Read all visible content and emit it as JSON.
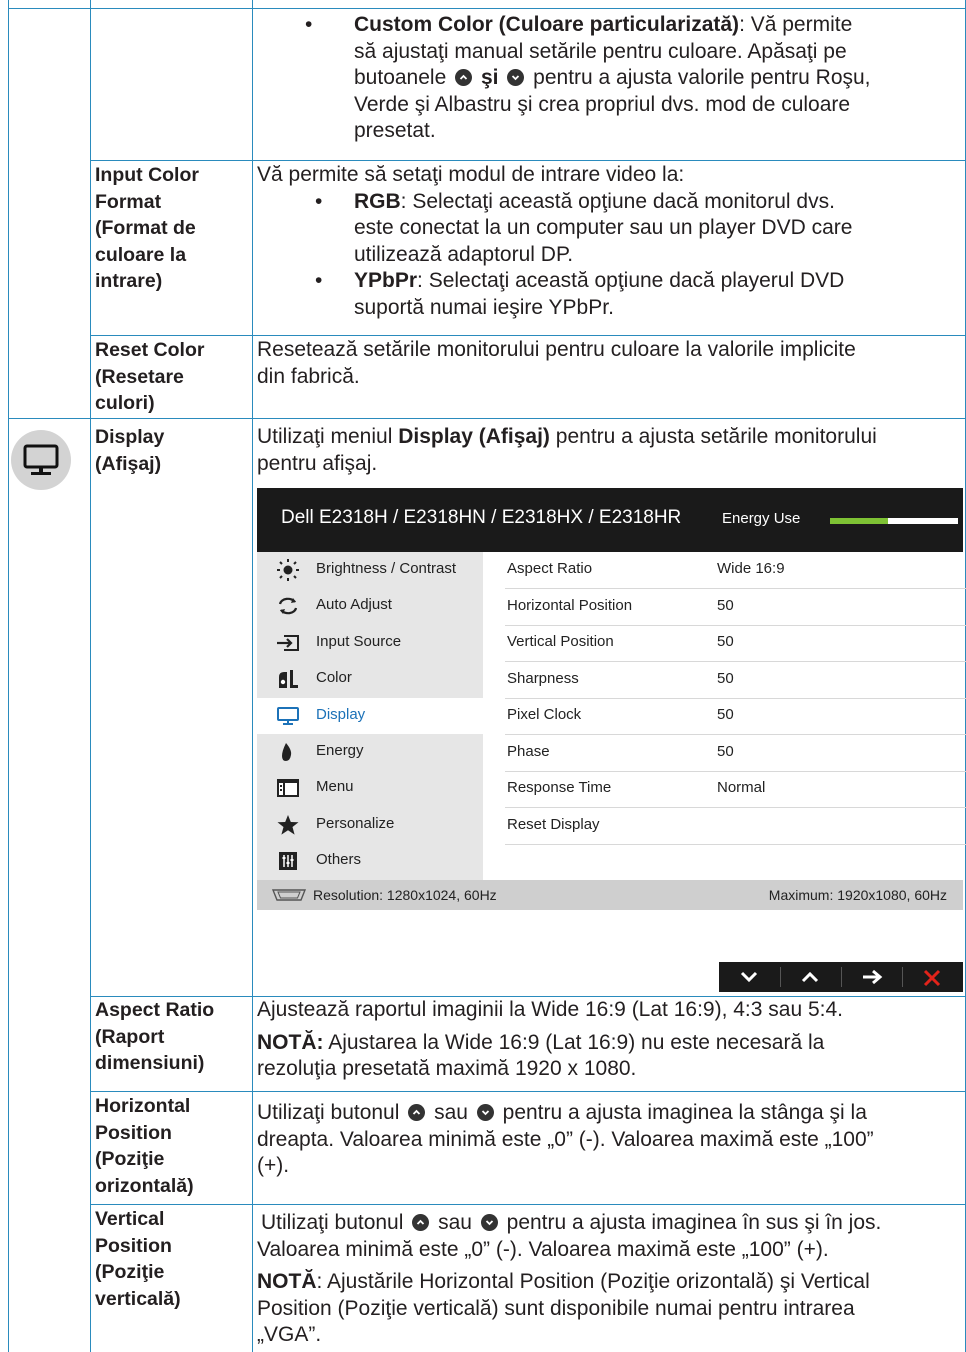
{
  "rows": {
    "custom_color": {
      "bullet": "•",
      "title": "Custom Color (Culoare particularizată)",
      "line1_rest": ": Vă permite",
      "line2": "să ajustaţi manual setările pentru culoare. Apăsaţi pe",
      "line3_a": "butoanele",
      "line3_b": "şi",
      "line3_c": "pentru a ajusta valorile pentru Roşu,",
      "line4": "Verde şi Albastru şi crea propriul dvs. mod de culoare",
      "line5": "presetat."
    },
    "input_color_format": {
      "label": [
        "Input Color",
        "Format",
        "(Format de",
        "culoare la",
        "intrare)"
      ],
      "intro": "Vă permite să setaţi modul de intrare video la:",
      "bullet": "•",
      "rgb_title": "RGB",
      "rgb_line1": ": Selectaţi această opţiune dacă monitorul dvs.",
      "rgb_line2": "este conectat la un computer sau un player DVD care",
      "rgb_line3": "utilizează adaptorul DP.",
      "ypbpr_title": "YPbPr",
      "ypbpr_line1": ": Selectaţi această opţiune dacă playerul DVD",
      "ypbpr_line2": "suportă numai ieşire YPbPr."
    },
    "reset_color": {
      "label": [
        "Reset Color",
        "(Resetare",
        "culori)"
      ],
      "line1": "Resetează setările monitorului pentru culoare la valorile implicite",
      "line2": "din fabrică."
    },
    "display": {
      "label": [
        "Display",
        "(Afişaj)"
      ],
      "line1_a": "Utilizaţi meniul",
      "line1_b": "Display (Afişaj)",
      "line1_c": "pentru a ajusta setările monitorului",
      "line2": "pentru afişaj."
    },
    "aspect_ratio": {
      "label": [
        "Aspect Ratio",
        "(Raport",
        "dimensiuni)"
      ],
      "line1": "Ajustează raportul imaginii la Wide 16:9 (Lat 16:9), 4:3 sau 5:4.",
      "note_label": "NOTĂ:",
      "note_line1": "Ajustarea la Wide 16:9 (Lat 16:9) nu este necesară la",
      "note_line2": "rezoluţia presetată maximă 1920 x 1080."
    },
    "horizontal_position": {
      "label": [
        "Horizontal",
        "Position",
        "(Poziţie",
        "orizontală)"
      ],
      "line1_a": "Utilizaţi butonul",
      "line1_b": "sau",
      "line1_c": "pentru a ajusta imaginea la stânga şi la",
      "line2": "dreapta. Valoarea minimă este „0” (-). Valoarea maximă este „100”",
      "line3": "(+)."
    },
    "vertical_position": {
      "label": [
        "Vertical",
        "Position",
        "(Poziţie",
        "verticală)"
      ],
      "line1_a": "Utilizaţi butonul",
      "line1_b": "sau",
      "line1_c": "pentru a ajusta imaginea în sus şi în jos.",
      "line2": "Valoarea minimă este „0” (-). Valoarea maximă este „100” (+).",
      "note_label": "NOTĂ",
      "note_line1": ": Ajustările Horizontal Position (Poziţie orizontală) şi Vertical",
      "note_line2": "Position (Poziţie verticală) sunt disponibile numai pentru intrarea",
      "note_line3": "„VGA”."
    }
  },
  "osd": {
    "title": "Dell E2318H / E2318HN / E2318HX / E2318HR",
    "energy_label": "Energy Use",
    "energy_level": 0.45,
    "menu": [
      {
        "label": "Brightness / Contrast",
        "icon": "sun-icon"
      },
      {
        "label": "Auto Adjust",
        "icon": "auto-adjust-icon"
      },
      {
        "label": "Input Source",
        "icon": "input-source-icon"
      },
      {
        "label": "Color",
        "icon": "color-icon"
      },
      {
        "label": "Display",
        "icon": "display-icon"
      },
      {
        "label": "Energy",
        "icon": "energy-icon"
      },
      {
        "label": "Menu",
        "icon": "menu-icon"
      },
      {
        "label": "Personalize",
        "icon": "star-icon"
      },
      {
        "label": "Others",
        "icon": "others-icon"
      }
    ],
    "active_menu": "Display",
    "settings": [
      {
        "name": "Aspect Ratio",
        "value": "Wide 16:9"
      },
      {
        "name": "Horizontal Position",
        "value": "50"
      },
      {
        "name": "Vertical Position",
        "value": "50"
      },
      {
        "name": "Sharpness",
        "value": "50"
      },
      {
        "name": "Pixel Clock",
        "value": "50"
      },
      {
        "name": "Phase",
        "value": "50"
      },
      {
        "name": "Response Time",
        "value": "Normal"
      },
      {
        "name": "Reset Display",
        "value": ""
      }
    ],
    "resolution": "Resolution: 1280x1024, 60Hz",
    "maximum": "Maximum: 1920x1080, 60Hz",
    "nav_buttons": [
      "chevron-down-icon",
      "chevron-up-icon",
      "arrow-right-icon",
      "close-icon"
    ],
    "colors": {
      "accent": "#1c72b8",
      "energy": "#7ec234",
      "close": "#e2231a",
      "rule": "#2a8bbd"
    }
  }
}
